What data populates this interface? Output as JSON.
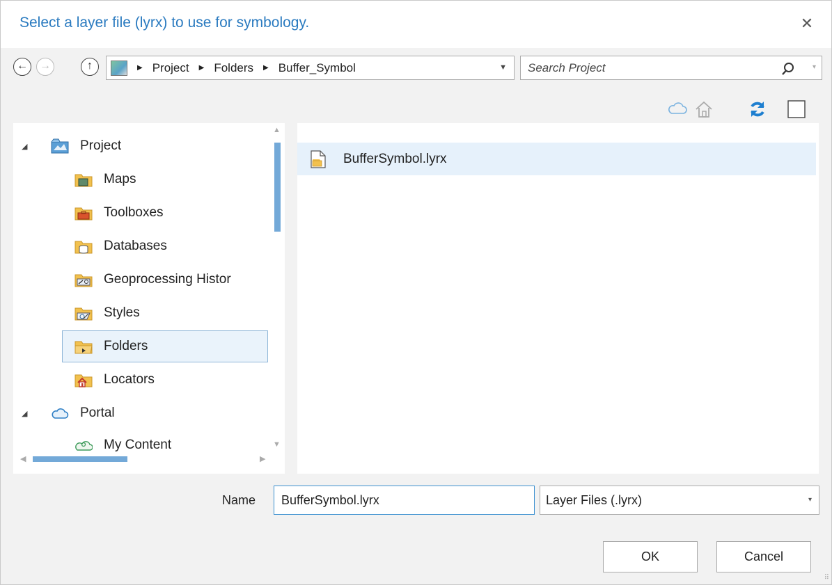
{
  "dialog": {
    "title": "Select a layer file (lyrx) to use for symbology.",
    "close_glyph": "✕"
  },
  "nav": {
    "back_glyph": "←",
    "forward_glyph": "→",
    "up_glyph": "↑",
    "breadcrumb": [
      "Project",
      "Folders",
      "Buffer_Symbol"
    ],
    "breadcrumb_sep": "▶",
    "dropdown_glyph": "▼"
  },
  "search": {
    "placeholder": "Search Project",
    "caret": "▾"
  },
  "toolbar": {
    "icons": [
      "cloud-icon",
      "home-icon",
      "refresh-icon",
      "checkbox-icon"
    ]
  },
  "tree": {
    "expander": "◢",
    "items": [
      {
        "label": "Project",
        "icon": "project-icon",
        "level": 0,
        "expanded": true
      },
      {
        "label": "Maps",
        "icon": "maps-folder-icon",
        "level": 1
      },
      {
        "label": "Toolboxes",
        "icon": "toolboxes-folder-icon",
        "level": 1
      },
      {
        "label": "Databases",
        "icon": "databases-folder-icon",
        "level": 1
      },
      {
        "label": "Geoprocessing Histor",
        "icon": "geoprocessing-history-icon",
        "level": 1
      },
      {
        "label": "Styles",
        "icon": "styles-folder-icon",
        "level": 1
      },
      {
        "label": "Folders",
        "icon": "folders-icon",
        "level": 1,
        "selected": true
      },
      {
        "label": "Locators",
        "icon": "locators-folder-icon",
        "level": 1
      },
      {
        "label": "Portal",
        "icon": "portal-cloud-icon",
        "level": 0,
        "expanded": true
      },
      {
        "label": "My Content",
        "icon": "my-content-icon",
        "level": 1
      }
    ],
    "scroll_up": "▲",
    "scroll_down": "▼",
    "scroll_left": "◀",
    "scroll_right": "▶"
  },
  "file_list": {
    "items": [
      {
        "name": "BufferSymbol.lyrx",
        "icon": "layer-file-icon",
        "selected": true
      }
    ]
  },
  "footer": {
    "name_label": "Name",
    "name_value": "BufferSymbol.lyrx",
    "file_type": "Layer Files (.lyrx)",
    "type_caret": "▾",
    "ok_label": "OK",
    "cancel_label": "Cancel",
    "grip": "⠿"
  },
  "colors": {
    "title": "#2b7bc0",
    "selection": "#e6f1fb",
    "selection_border": "#8fb6d8",
    "scroll_thumb": "#73a9d8",
    "input_focus": "#3a8fd0",
    "refresh": "#1e7fd0"
  }
}
